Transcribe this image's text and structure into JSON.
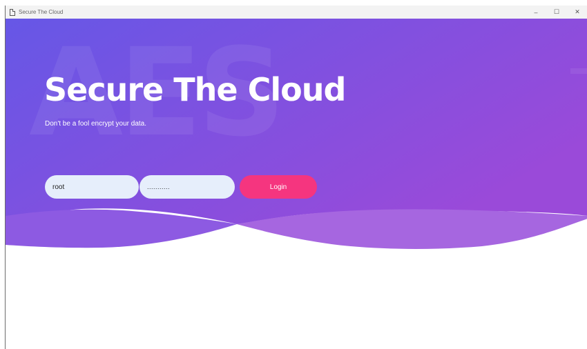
{
  "window": {
    "title": "Secure The Cloud",
    "icon": "document-icon",
    "controls": {
      "minimize": "–",
      "maximize": "☐",
      "close": "✕"
    }
  },
  "hero": {
    "watermark": "AES",
    "title": "Secure The Cloud",
    "subtitle": "Don't be a fool encrypt your data."
  },
  "login": {
    "username_value": "root",
    "password_value": "...........",
    "button_label": "Login"
  },
  "colors": {
    "gradient_start": "#6657e6",
    "gradient_end": "#9a4ad9",
    "wave_light": "#a666e0",
    "button": "#f5357f",
    "input_bg": "#e6eefb"
  }
}
